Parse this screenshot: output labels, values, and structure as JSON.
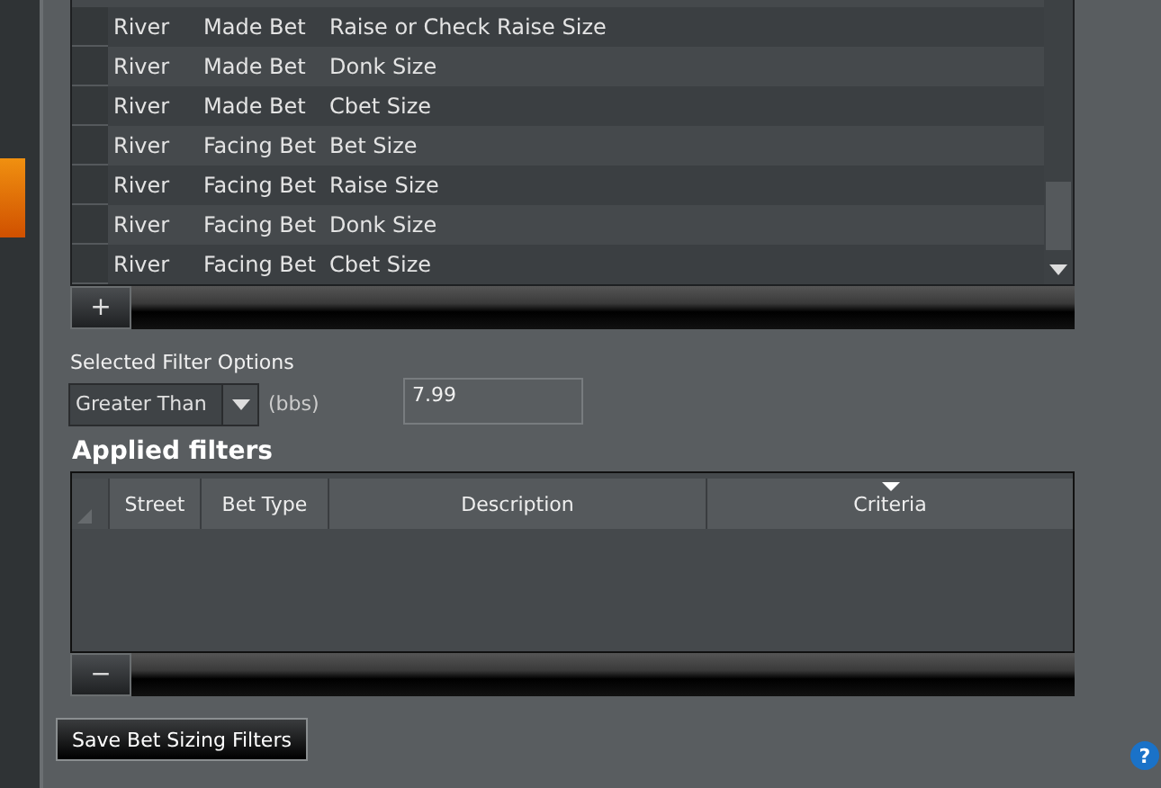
{
  "bet_table": {
    "rows": [
      {
        "street": "River",
        "bet_type": "Made Bet",
        "description": "Raise or Check Raise Size"
      },
      {
        "street": "River",
        "bet_type": "Made Bet",
        "description": "Donk Size"
      },
      {
        "street": "River",
        "bet_type": "Made Bet",
        "description": "Cbet Size"
      },
      {
        "street": "River",
        "bet_type": "Facing Bet",
        "description": "Bet Size"
      },
      {
        "street": "River",
        "bet_type": "Facing Bet",
        "description": "Raise Size"
      },
      {
        "street": "River",
        "bet_type": "Facing Bet",
        "description": "Donk Size"
      },
      {
        "street": "River",
        "bet_type": "Facing Bet",
        "description": "Cbet Size"
      }
    ]
  },
  "add_button": "+",
  "filter_options": {
    "label": "Selected Filter Options",
    "comparator": "Greater Than",
    "unit": "(bbs)",
    "value": "7.99"
  },
  "applied_filters": {
    "title": "Applied filters",
    "columns": [
      {
        "label": "Street",
        "sorted": false
      },
      {
        "label": "Bet Type",
        "sorted": false
      },
      {
        "label": "Description",
        "sorted": false
      },
      {
        "label": "Criteria",
        "sorted": true
      }
    ]
  },
  "remove_button": "−",
  "save_button": "Save Bet Sizing Filters",
  "help": "?"
}
